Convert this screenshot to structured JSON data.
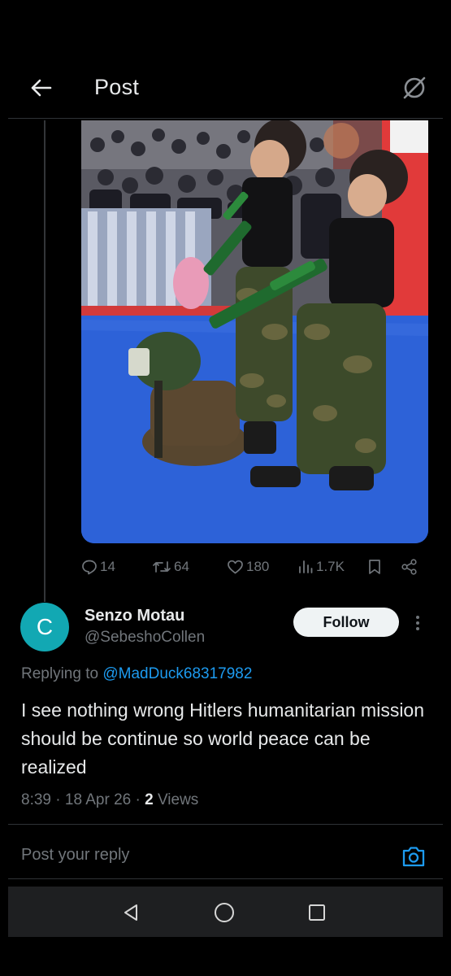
{
  "header": {
    "title": "Post",
    "back_icon": "arrow-left-icon",
    "topic_icon": "grok-slash-circle-icon"
  },
  "post_media": {
    "kind": "photo"
  },
  "actions": {
    "replies": "14",
    "reposts": "64",
    "likes": "180",
    "views": "1.7K"
  },
  "reply": {
    "avatar_letter": "C",
    "avatar_color": "#12a8b3",
    "display_name": "Senzo Motau",
    "handle": "@SebeshoCollen",
    "follow_label": "Follow",
    "replying_prefix": "Replying to",
    "replying_to": "@MadDuck68317982",
    "text": "I see nothing wrong Hitlers humanitarian mission should be continue so world peace can be realized",
    "time": "8:39",
    "date": "18 Apr 26",
    "views_count": "2",
    "views_label": "Views"
  },
  "reply_bar": {
    "placeholder": "Post your reply"
  },
  "colors": {
    "background": "#000000",
    "link": "#1d9bf0",
    "muted": "#71767b",
    "text": "#e7e9ea"
  }
}
